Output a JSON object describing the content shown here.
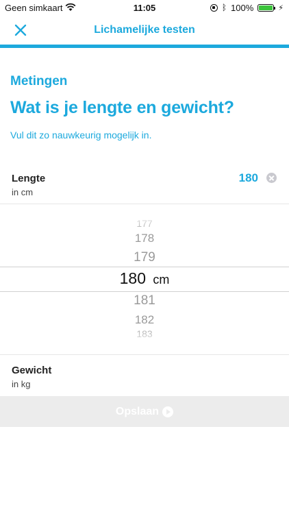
{
  "status_bar": {
    "carrier": "Geen simkaart",
    "time": "11:05",
    "battery": "100%",
    "battery_level": 1.0,
    "battery_color": "#3cc43c"
  },
  "nav": {
    "title": "Lichamelijke testen",
    "close_icon": "close-icon",
    "accent_color": "#1ca9dd"
  },
  "header": {
    "section": "Metingen",
    "question": "Wat is je lengte en gewicht?",
    "hint": "Vul dit zo nauwkeurig mogelijk in."
  },
  "length": {
    "label": "Lengte",
    "unit": "in cm",
    "value": "180",
    "clear_icon": "clear-icon"
  },
  "picker": {
    "above": [
      "177",
      "178",
      "179"
    ],
    "selected": "180",
    "unit": "cm",
    "below": [
      "181",
      "182",
      "183"
    ]
  },
  "weight": {
    "label": "Gewicht",
    "unit": "in kg"
  },
  "save": {
    "label": "Opslaan",
    "icon": "play-circle-icon"
  }
}
